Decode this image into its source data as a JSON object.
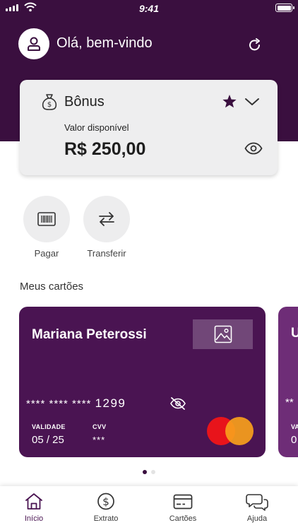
{
  "status_bar": {
    "time": "9:41"
  },
  "header": {
    "greeting": "Olá, bem-vindo"
  },
  "balance": {
    "title": "Bônus",
    "label": "Valor disponível",
    "amount": "R$ 250,00"
  },
  "actions": [
    {
      "label": "Pagar",
      "icon": "barcode-icon"
    },
    {
      "label": "Transferir",
      "icon": "transfer-arrows-icon"
    }
  ],
  "cards_section": {
    "title": "Meus cartões"
  },
  "card": {
    "holder": "Mariana Peterossi",
    "masked_number": "**** **** ****",
    "last4": "1299",
    "validity_label": "VALIDADE",
    "validity": "05 / 25",
    "cvv_label": "CVV",
    "cvv": "***",
    "brand": "mastercard-logo",
    "color": "#4a1452"
  },
  "next_card": {
    "initial": "U",
    "masked_number": "**",
    "validity_label": "VA",
    "validity": "0"
  },
  "carousel": {
    "count": 2,
    "active": 0
  },
  "tabs": [
    {
      "label": "Início",
      "icon": "home-icon",
      "active": true
    },
    {
      "label": "Extrato",
      "icon": "dollar-circle-icon"
    },
    {
      "label": "Cartões",
      "icon": "card-icon"
    },
    {
      "label": "Ajuda",
      "icon": "chat-bubbles-icon"
    }
  ],
  "colors": {
    "brand": "#3a0f3f",
    "card": "#4a1452",
    "accent_star": "#3a0f3f"
  }
}
